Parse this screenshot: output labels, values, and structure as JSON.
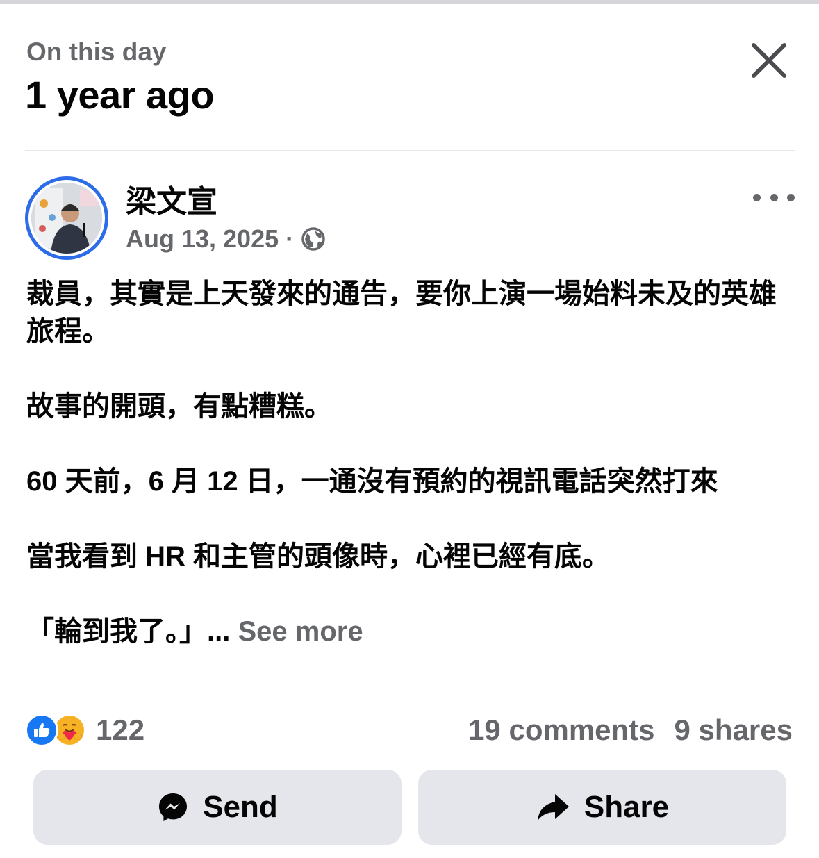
{
  "header": {
    "kicker": "On this day",
    "title": "1 year ago"
  },
  "post": {
    "author": "梁文宣",
    "date": "Aug 13, 2025",
    "separator": "·",
    "audience_icon": "globe-icon",
    "paragraphs": [
      "裁員，其實是上天發來的通告，要你上演一場始料未及的英雄旅程。",
      "故事的開頭，有點糟糕。",
      "60 天前，6 月 12 日，一通沒有預約的視訊電話突然打來",
      "當我看到 HR 和主管的頭像時，心裡已經有底。"
    ],
    "last_line": "「輪到我了。」...",
    "see_more": "See more"
  },
  "stats": {
    "reaction_icons": [
      "like-icon",
      "care-icon"
    ],
    "reaction_count": "122",
    "comments": "19 comments",
    "shares": "9 shares"
  },
  "actions": {
    "send_label": "Send",
    "send_icon": "messenger-icon",
    "share_label": "Share",
    "share_icon": "share-arrow-icon"
  },
  "colors": {
    "accent_blue": "#1877f2",
    "avatar_ring": "#2d6ce8",
    "secondary_text": "#65676b",
    "button_bg": "#e4e6eb",
    "care_yellow": "#f7b125"
  }
}
